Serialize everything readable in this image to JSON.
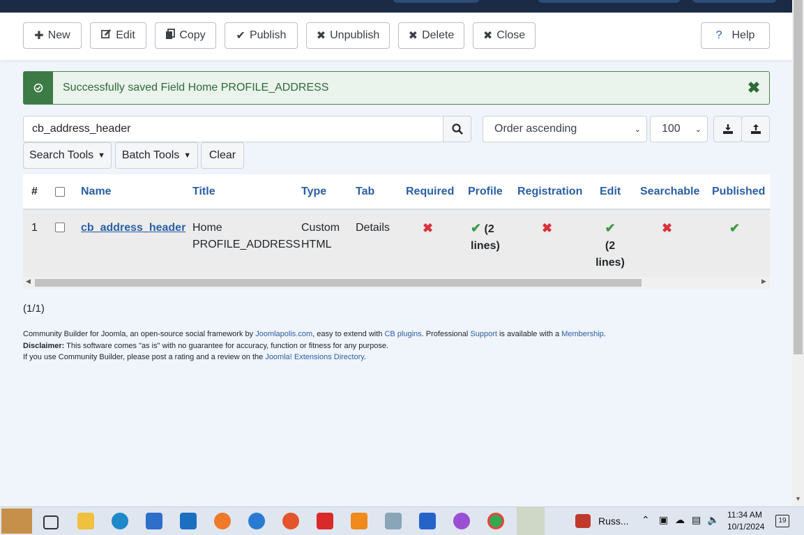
{
  "toolbar": {
    "new": "New",
    "edit": "Edit",
    "copy": "Copy",
    "publish": "Publish",
    "unpublish": "Unpublish",
    "delete": "Delete",
    "close": "Close",
    "help": "Help"
  },
  "alert": {
    "message": "Successfully saved Field Home PROFILE_ADDRESS"
  },
  "filters": {
    "search_value": "cb_address_header",
    "order": "Order ascending",
    "limit": "100",
    "search_tools": "Search Tools",
    "batch_tools": "Batch Tools",
    "clear": "Clear"
  },
  "table": {
    "headers": {
      "num": "#",
      "name": "Name",
      "title": "Title",
      "type": "Type",
      "tab": "Tab",
      "required": "Required",
      "profile": "Profile",
      "registration": "Registration",
      "edit": "Edit",
      "searchable": "Searchable",
      "published": "Published"
    },
    "rows": [
      {
        "num": "1",
        "name": "cb_address_header",
        "title_line1": "Home",
        "title_line2": "PROFILE_ADDRESS",
        "type_line1": "Custom",
        "type_line2": "HTML",
        "tab": "Details",
        "profile_note_1": "(2",
        "profile_note_2": "lines)",
        "edit_note_1": "(2",
        "edit_note_2": "lines)"
      }
    ]
  },
  "pagination": "(1/1)",
  "footer": {
    "l1_a": "Community Builder for Joomla, an open-source social framework by ",
    "l1_link1": "Joomlapolis.com",
    "l1_b": ", easy to extend with ",
    "l1_link2": "CB plugins",
    "l1_c": ". Professional ",
    "l1_link3": "Support",
    "l1_d": " is available with a ",
    "l1_link4": "Membership",
    "l1_e": ".",
    "l2_bold": "Disclaimer:",
    "l2_text": " This software comes \"as is\" with no guarantee for accuracy, function or fitness for any purpose.",
    "l3_a": "If you use Community Builder, please post a rating and a review on the ",
    "l3_link": "Joomla! Extensions Directory",
    "l3_b": "."
  },
  "taskbar": {
    "app_label": "Russ...",
    "time": "11:34 AM",
    "date": "10/1/2024",
    "notif_count": "19"
  },
  "colors": {
    "accent": "#2a5fa5",
    "success": "#3c7a46",
    "danger": "#d9323a",
    "check": "#3b9a44"
  }
}
